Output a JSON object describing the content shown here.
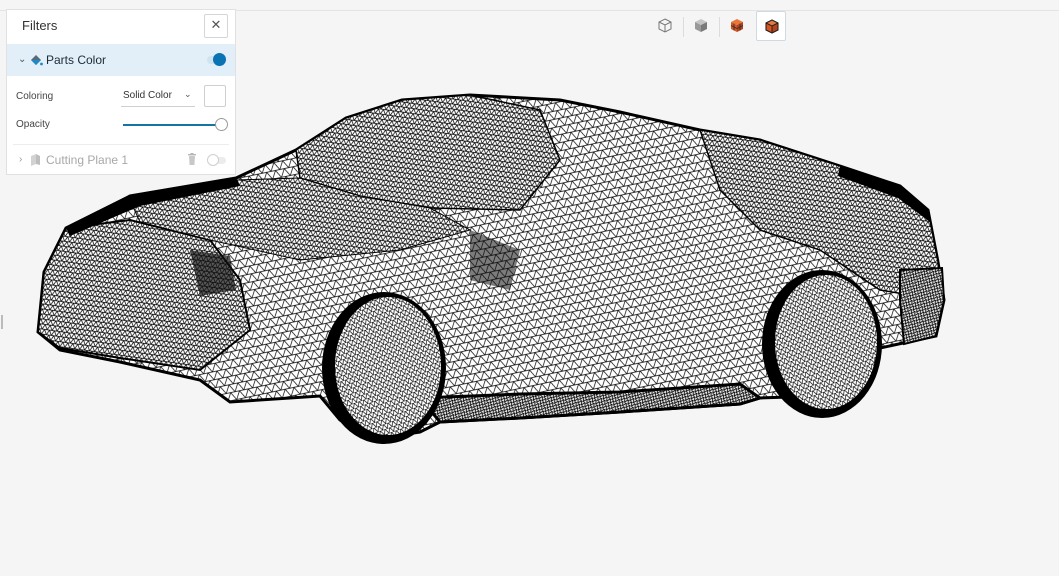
{
  "filters_panel": {
    "title": "Filters",
    "close_glyph": "✕",
    "items": [
      {
        "label": "Parts Color",
        "expanded": true,
        "enabled": true,
        "icon": "paint-bucket-icon",
        "fields": {
          "coloring_label": "Coloring",
          "coloring_value": "Solid Color",
          "swatch_color": "#ffffff",
          "opacity_label": "Opacity",
          "opacity_value": 1.0
        }
      },
      {
        "label": "Cutting Plane 1",
        "expanded": false,
        "enabled": false,
        "icon": "cutting-plane-icon"
      }
    ]
  },
  "toolbar": {
    "buttons": [
      {
        "name": "surfaces-view",
        "icon": "cube-outline-icon",
        "selected": false
      },
      {
        "name": "surfaces-with-edges-view",
        "icon": "cube-shaded-icon",
        "selected": false
      },
      {
        "name": "mesh-view",
        "icon": "cube-mesh-orange-icon",
        "selected": false
      },
      {
        "name": "mesh-detail-view",
        "icon": "cube-mesh-highlight-icon",
        "selected": true
      }
    ]
  },
  "viewport": {
    "model": "car-mesh-wireframe",
    "mesh_color": "#000000",
    "background": "#f5f5f5"
  },
  "colors": {
    "accent": "#0b73b2",
    "active_row": "#e2eff8",
    "orange_icon": "#d9541e"
  }
}
